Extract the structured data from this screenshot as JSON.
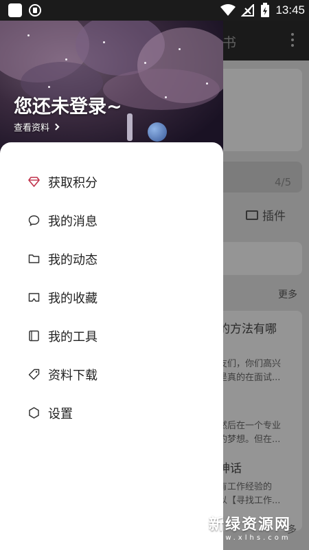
{
  "status_bar": {
    "time": "13:45",
    "icons": [
      "app-icon",
      "shield-icon",
      "wifi-icon",
      "signal-off-icon",
      "battery-charging-icon"
    ]
  },
  "background_app": {
    "title_fragment": "书",
    "page_indicator": "4/5",
    "plugin_label": "插件",
    "more_label": "更多",
    "article_title": "的方法有哪",
    "article_lines": [
      "友们，你们高兴",
      "是真的在面试..."
    ],
    "article2_lines": [
      "然后在一个专业",
      "的梦想。但在..."
    ],
    "article3_title": "神话",
    "article3_lines": [
      "有工作经验的",
      "以【寻找工作..."
    ],
    "more_label_2": "多"
  },
  "drawer": {
    "header": {
      "login_prompt": "您还未登录~",
      "view_profile": "查看资料"
    },
    "menu": [
      {
        "label": "获取积分",
        "icon": "diamond-icon"
      },
      {
        "label": "我的消息",
        "icon": "chat-bubble-icon"
      },
      {
        "label": "我的动态",
        "icon": "folder-icon"
      },
      {
        "label": "我的收藏",
        "icon": "bookmark-tray-icon"
      },
      {
        "label": "我的工具",
        "icon": "notebook-icon"
      },
      {
        "label": "资料下载",
        "icon": "tag-icon"
      },
      {
        "label": "设置",
        "icon": "hexagon-settings-icon"
      }
    ]
  },
  "watermark": {
    "name": "新绿资源网",
    "url": "www.xlhs.com"
  }
}
